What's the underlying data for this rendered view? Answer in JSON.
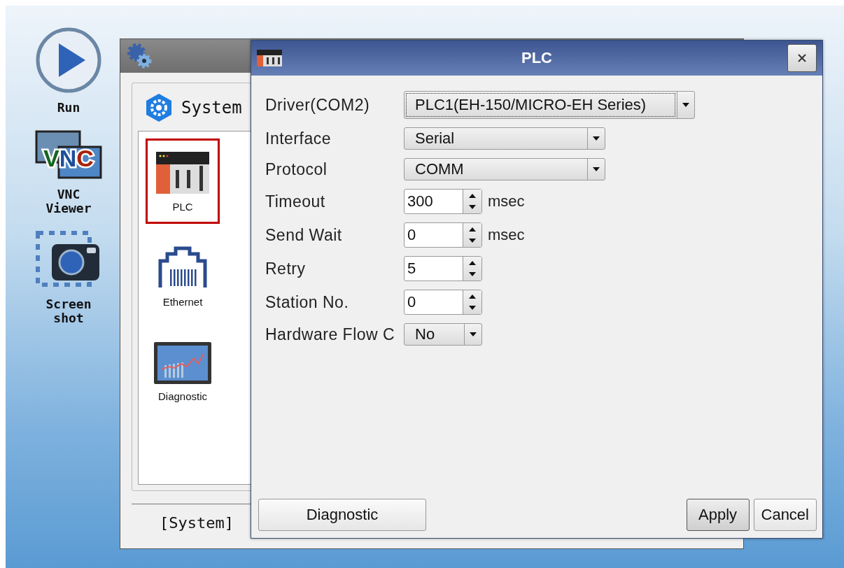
{
  "sidebar": {
    "items": [
      {
        "kind": "run",
        "label": "Run"
      },
      {
        "kind": "vnc",
        "label": "VNC Viewer",
        "icon_text": "VNC"
      },
      {
        "kind": "screenshot",
        "label": "Screen shot"
      }
    ]
  },
  "back_window": {
    "header": "System",
    "items": [
      {
        "kind": "plc",
        "label": "PLC",
        "selected": true
      },
      {
        "kind": "ethernet",
        "label": "Ethernet",
        "selected": false
      },
      {
        "kind": "diagnostic",
        "label": "Diagnostic",
        "selected": false
      }
    ],
    "footer": "[System]"
  },
  "dialog": {
    "title": "PLC",
    "fields": [
      {
        "kind": "dropdown",
        "label": "Driver(COM2)",
        "value": "PLC1(EH-150/MICRO-EH Series)",
        "focused": true
      },
      {
        "kind": "dropdown",
        "label": "Interface",
        "value": "Serial",
        "focused": false
      },
      {
        "kind": "dropdown",
        "label": "Protocol",
        "value": "COMM",
        "focused": false
      },
      {
        "kind": "spin",
        "label": "Timeout",
        "value": "300",
        "unit": "msec"
      },
      {
        "kind": "spin",
        "label": "Send Wait",
        "value": "0",
        "unit": "msec"
      },
      {
        "kind": "spin",
        "label": "Retry",
        "value": "5"
      },
      {
        "kind": "spin",
        "label": "Station No.",
        "value": "0"
      },
      {
        "kind": "small-dropdown",
        "label": "Hardware Flow C",
        "value": "No",
        "focused": false
      }
    ],
    "buttons": [
      {
        "label": "Diagnostic",
        "default": false
      },
      {
        "label": "Apply",
        "default": true
      },
      {
        "label": "Cancel",
        "default": false
      }
    ]
  }
}
